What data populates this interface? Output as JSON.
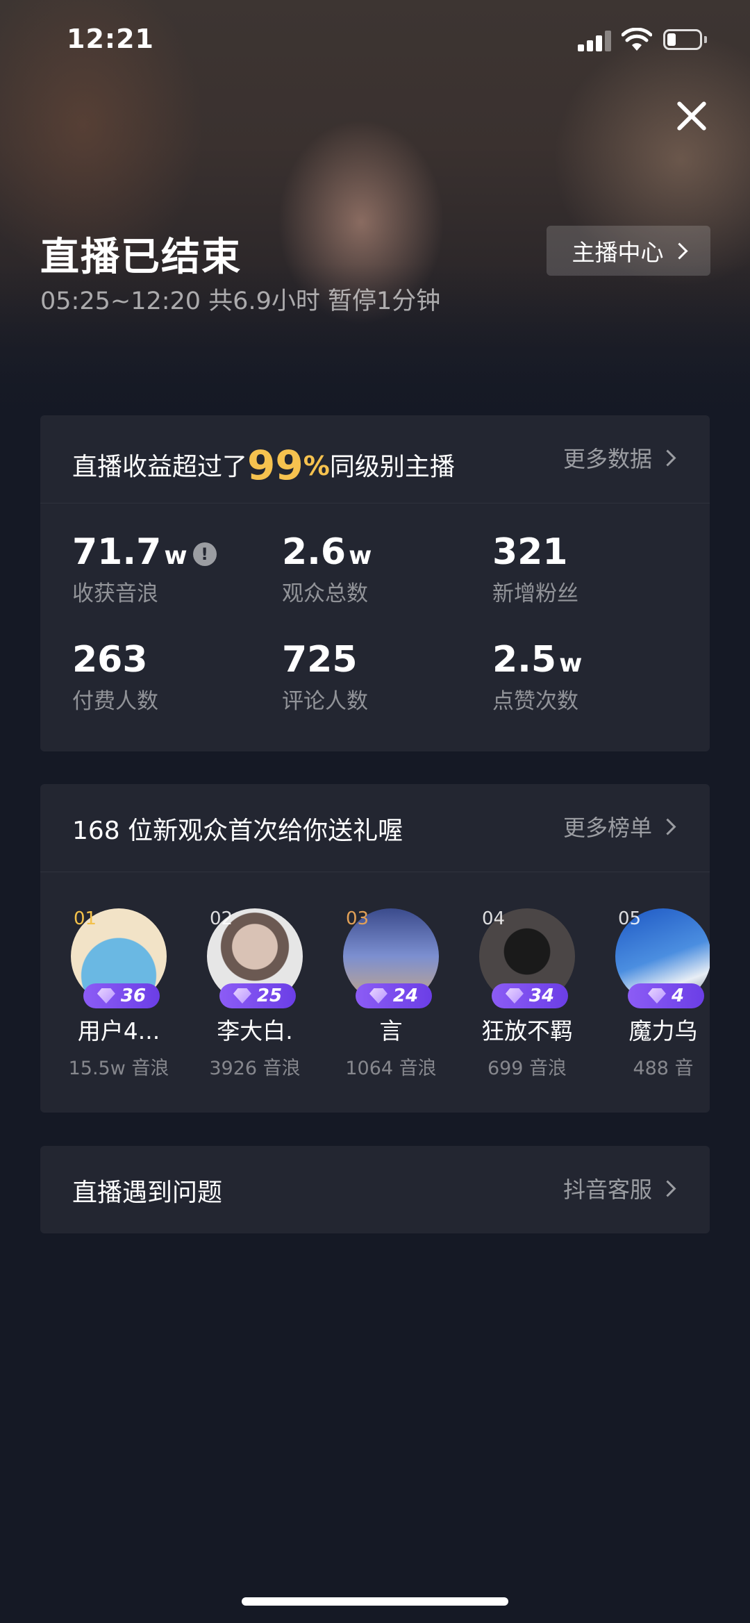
{
  "status_bar": {
    "time": "12:21"
  },
  "header": {
    "title": "直播已结束",
    "subtitle": "05:25~12:20 共6.9小时 暂停1分钟",
    "host_center_label": "主播中心"
  },
  "earnings": {
    "prefix": "直播收益超过了",
    "percent": "99",
    "percent_sign": "%",
    "suffix": "同级别主播",
    "more_label": "更多数据",
    "stats": [
      {
        "value": "71.7",
        "unit": "w",
        "label": "收获音浪"
      },
      {
        "value": "2.6",
        "unit": "w",
        "label": "观众总数"
      },
      {
        "value": "321",
        "unit": "",
        "label": "新增粉丝"
      },
      {
        "value": "263",
        "unit": "",
        "label": "付费人数"
      },
      {
        "value": "725",
        "unit": "",
        "label": "评论人数"
      },
      {
        "value": "2.5",
        "unit": "w",
        "label": "点赞次数"
      }
    ]
  },
  "gifters": {
    "title": "168 位新观众首次给你送礼喔",
    "more_label": "更多榜单",
    "items": [
      {
        "rank": "01",
        "level": "36",
        "name": "用户4...",
        "value": "15.5w 音浪"
      },
      {
        "rank": "02",
        "level": "25",
        "name": "李大白.",
        "value": "3926 音浪"
      },
      {
        "rank": "03",
        "level": "24",
        "name": "言",
        "value": "1064 音浪"
      },
      {
        "rank": "04",
        "level": "34",
        "name": "狂放不羁",
        "value": "699 音浪"
      },
      {
        "rank": "05",
        "level": "4",
        "name": "魔力乌",
        "value": "488 音"
      }
    ]
  },
  "problem": {
    "title": "直播遇到问题",
    "link_label": "抖音客服"
  },
  "colors": {
    "background": "#151925",
    "card": "#232631",
    "accent_gold": "#f6c24f",
    "level_badge": "#7b4cf0"
  }
}
